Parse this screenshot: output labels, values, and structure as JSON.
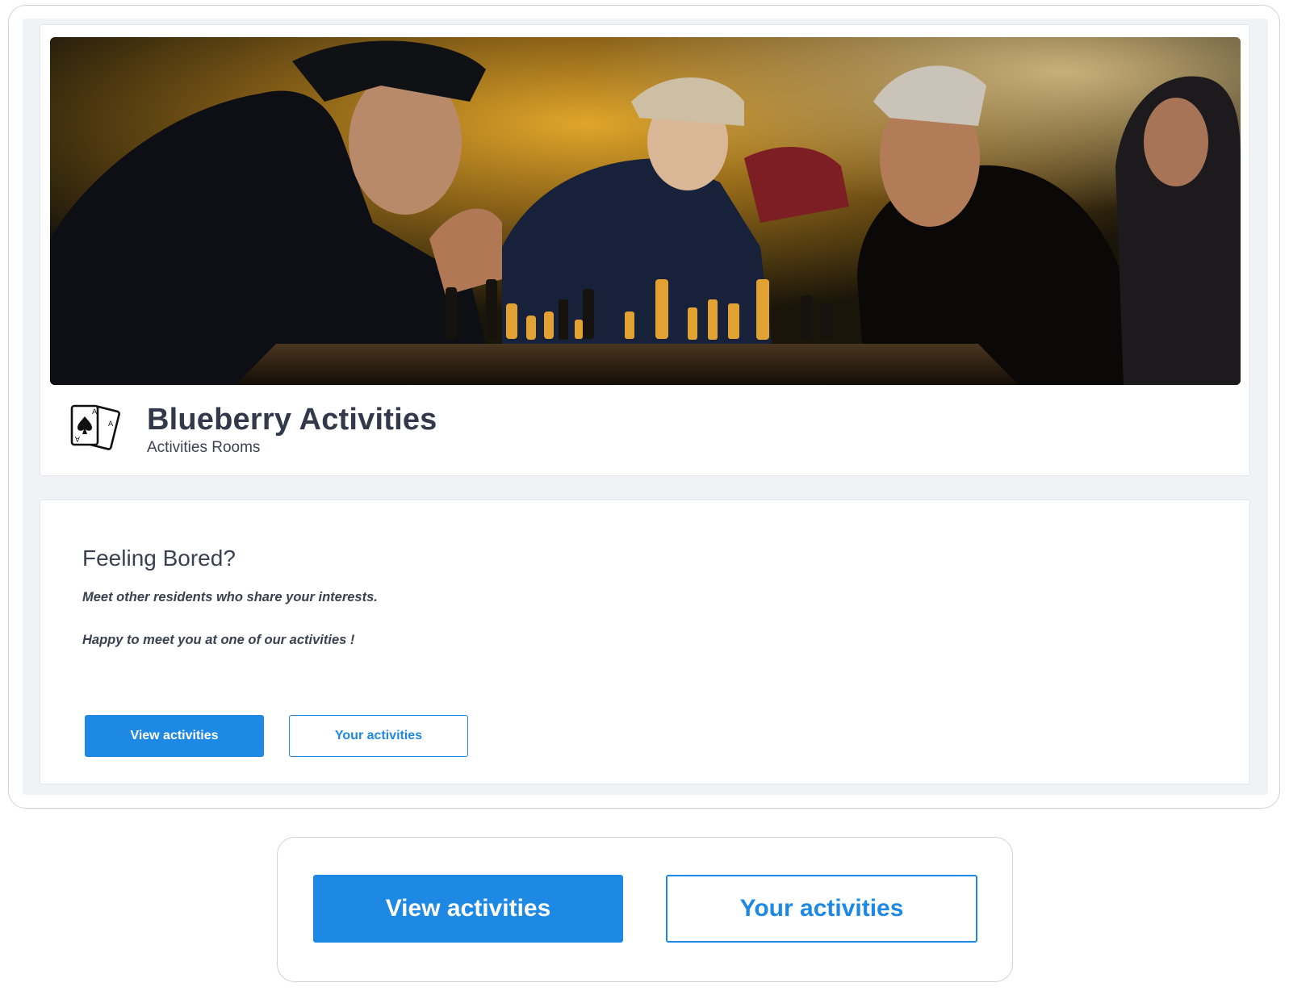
{
  "app": {
    "title": "Blueberry Activities",
    "subtitle": "Activities Rooms",
    "logo_icon": "playing-cards-icon"
  },
  "hero": {
    "image_icon": "chess-players-photo"
  },
  "intro": {
    "heading": "Feeling Bored?",
    "line1": "Meet other residents who share your interests.",
    "line2": "Happy to meet you at one of our activities !"
  },
  "actions": {
    "view_label": "View activities",
    "your_label": "Your activities"
  },
  "zoom": {
    "view_label": "View activities",
    "your_label": "Your activities"
  },
  "colors": {
    "accent": "#1e88e5",
    "panel_bg": "#f0f3f6",
    "text": "#33394a"
  }
}
